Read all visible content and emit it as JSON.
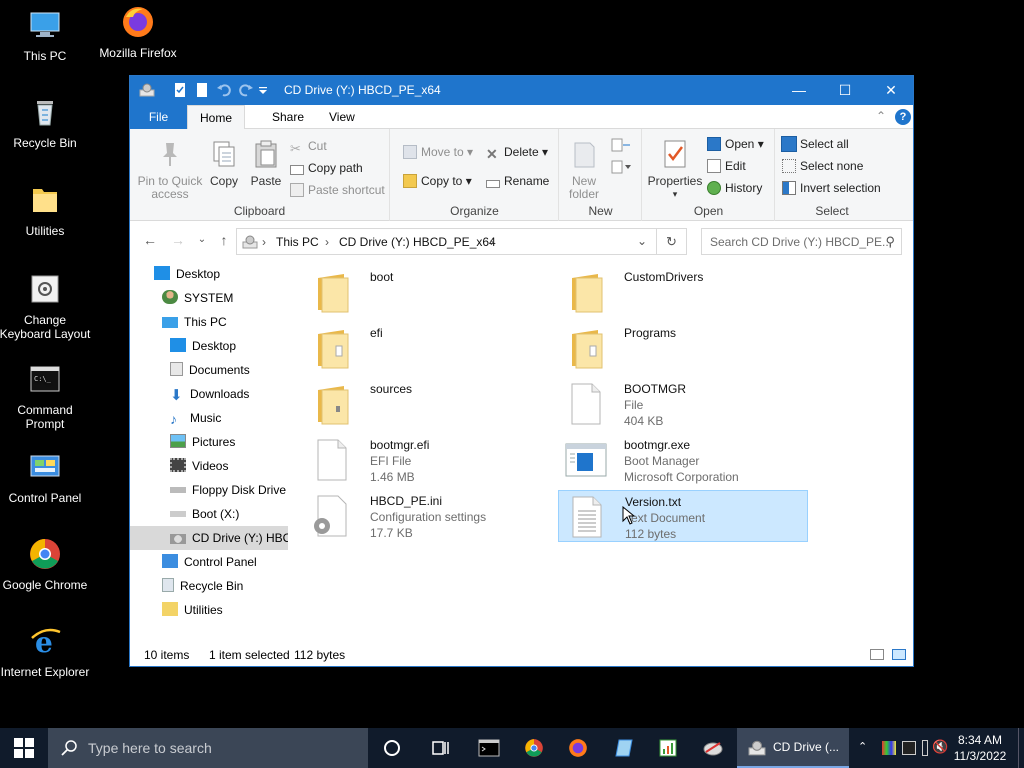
{
  "desktop": {
    "icons": [
      {
        "label": "This PC"
      },
      {
        "label": "Mozilla Firefox"
      },
      {
        "label": "Recycle Bin"
      },
      {
        "label": "Utilities"
      },
      {
        "label": "Change Keyboard Layout"
      },
      {
        "label": "Command Prompt"
      },
      {
        "label": "Control Panel"
      },
      {
        "label": "Google Chrome"
      },
      {
        "label": "Internet Explorer"
      }
    ]
  },
  "window": {
    "title": "CD Drive (Y:) HBCD_PE_x64",
    "tabs": [
      "File",
      "Home",
      "Share",
      "View"
    ],
    "ribbon": {
      "clipboard": {
        "label": "Clipboard",
        "pin": "Pin to Quick access",
        "copy": "Copy",
        "paste": "Paste",
        "cut": "Cut",
        "copy_path": "Copy path",
        "paste_shortcut": "Paste shortcut"
      },
      "organize": {
        "label": "Organize",
        "move_to": "Move to",
        "copy_to": "Copy to",
        "delete": "Delete",
        "rename": "Rename"
      },
      "new": {
        "label": "New",
        "new_folder": "New folder"
      },
      "open": {
        "label": "Open",
        "properties": "Properties",
        "open": "Open",
        "edit": "Edit",
        "history": "History"
      },
      "select": {
        "label": "Select",
        "select_all": "Select all",
        "select_none": "Select none",
        "invert": "Invert selection"
      }
    },
    "address": {
      "segments": [
        "This PC",
        "CD Drive (Y:) HBCD_PE_x64"
      ],
      "search_placeholder": "Search CD Drive (Y:) HBCD_PE..."
    },
    "nav": [
      {
        "label": "Desktop"
      },
      {
        "label": "SYSTEM"
      },
      {
        "label": "This PC"
      },
      {
        "label": "Desktop"
      },
      {
        "label": "Documents"
      },
      {
        "label": "Downloads"
      },
      {
        "label": "Music"
      },
      {
        "label": "Pictures"
      },
      {
        "label": "Videos"
      },
      {
        "label": "Floppy Disk Drive"
      },
      {
        "label": "Boot (X:)"
      },
      {
        "label": "CD Drive (Y:) HBC"
      },
      {
        "label": "Control Panel"
      },
      {
        "label": "Recycle Bin"
      },
      {
        "label": "Utilities"
      }
    ],
    "files": [
      {
        "name": "boot",
        "line2": "",
        "line3": ""
      },
      {
        "name": "CustomDrivers",
        "line2": "",
        "line3": ""
      },
      {
        "name": "efi",
        "line2": "",
        "line3": ""
      },
      {
        "name": "Programs",
        "line2": "",
        "line3": ""
      },
      {
        "name": "sources",
        "line2": "",
        "line3": ""
      },
      {
        "name": "BOOTMGR",
        "line2": "File",
        "line3": "404 KB"
      },
      {
        "name": "bootmgr.efi",
        "line2": "EFI File",
        "line3": "1.46 MB"
      },
      {
        "name": "bootmgr.exe",
        "line2": "Boot Manager",
        "line3": "Microsoft Corporation"
      },
      {
        "name": "HBCD_PE.ini",
        "line2": "Configuration settings",
        "line3": "17.7 KB"
      },
      {
        "name": "Version.txt",
        "line2": "Text Document",
        "line3": "112 bytes"
      }
    ],
    "status": {
      "count": "10 items",
      "selected": "1 item selected",
      "size": "112 bytes"
    }
  },
  "taskbar": {
    "search_placeholder": "Type here to search",
    "active_window": "CD Drive (...",
    "time": "8:34 AM",
    "date": "11/3/2022"
  },
  "colors": {
    "titlebar": "#1f75cc",
    "selection": "#cce8ff",
    "taskbar": "#101b2b"
  }
}
